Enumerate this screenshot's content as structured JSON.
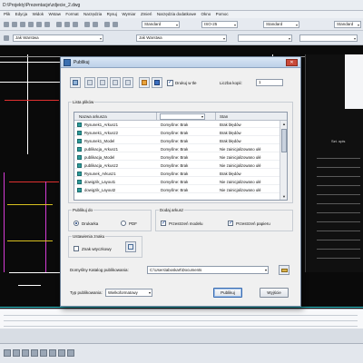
{
  "app": {
    "title": "D:\\Projekty\\Prezentacje\\zdjecie_2.dwg",
    "menu": [
      "Plik",
      "Edycja",
      "Widok",
      "Wstaw",
      "Format",
      "Narzędzia",
      "Rysuj",
      "Wymiar",
      "Zmień",
      "Narzędzia dodatkowe",
      "Okno",
      "Pomoc"
    ],
    "toolbar": {
      "layer_combo": "Jak Warstwa",
      "linetype_combo": "Jak Warstwa",
      "style_combo_1": "Standard",
      "style_combo_2": "ISO-25",
      "style_combo_3": "Standard",
      "style_combo_4": "Standard"
    },
    "right_panel": {
      "label": "Szt. opis"
    }
  },
  "dialog": {
    "title": "Publikuj",
    "close_glyph": "✕",
    "print_to_file": {
      "label": "Drukuj w tle",
      "checked": true
    },
    "copies": {
      "label": "Liczba kopii:",
      "value": "1"
    },
    "sheets": {
      "group_label": "Lista plików",
      "columns": [
        "Nazwa arkusza",
        "",
        "Stan"
      ],
      "rows": [
        {
          "name": "Rysunek1_Arkusz1",
          "setup": "Domyślne: Brak",
          "status": "Brak błędów"
        },
        {
          "name": "Rysunek1_Arkusz2",
          "setup": "Domyślne: Brak",
          "status": "Brak błędów"
        },
        {
          "name": "Rysunek1_Model",
          "setup": "Domyślne: Brak",
          "status": "Brak błędów"
        },
        {
          "name": "publikacja_Arkusz1",
          "setup": "Domyślne: Brak",
          "status": "Nie zainicjalizowano ukł"
        },
        {
          "name": "publikacja_Model",
          "setup": "Domyślne: Brak",
          "status": "Nie zainicjalizowano ukł"
        },
        {
          "name": "publikacja_Arkusz2",
          "setup": "Domyślne: Brak",
          "status": "Nie zainicjalizowano ukł"
        },
        {
          "name": "Rysunek_Arkusz1",
          "setup": "Domyślne: Brak",
          "status": "Brak błędów"
        },
        {
          "name": "dowigzik_Layout1",
          "setup": "Domyślne: Brak",
          "status": "Nie zainicjalizowano ukł"
        },
        {
          "name": "dowigzik_Layout2",
          "setup": "Domyślne: Brak",
          "status": "Nie zainicjalizowano ukł"
        }
      ]
    },
    "publish_to": {
      "group_label": "Publikuj do",
      "options": [
        {
          "label": "Drukarka",
          "selected": true
        },
        {
          "label": "PDF",
          "selected": false
        }
      ]
    },
    "include_when_adding": {
      "group_label": "Dodaj arkusz",
      "options": [
        {
          "label": "Przestrzeń modelu",
          "checked": true
        },
        {
          "label": "Przestrzeń papieru",
          "checked": true
        }
      ]
    },
    "security": {
      "group_label": "Ustawienia znaku",
      "option": {
        "label": "Znak wtyczkowy",
        "checked": false
      }
    },
    "default_folder": {
      "label": "Domyślny Katalog publikowania:",
      "value": "C:\\Users\\aboskart\\Documents"
    },
    "publish_type": {
      "label": "Typ publikowania:",
      "value": "Wielkoformatowy"
    },
    "buttons": {
      "publish": "Publikuj",
      "close": "Wyjście"
    }
  }
}
